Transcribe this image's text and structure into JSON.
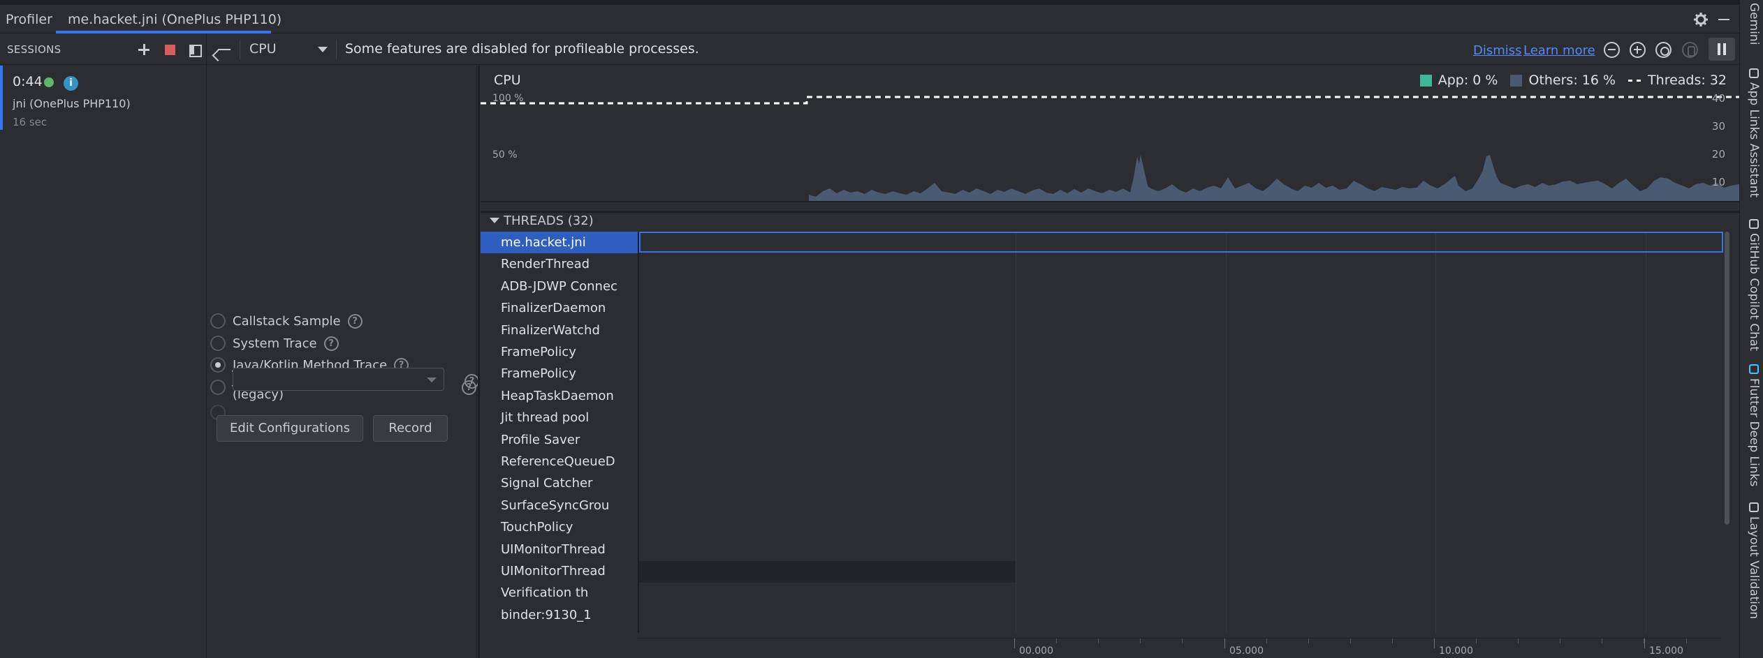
{
  "toolwindow": {
    "tabs": [
      "Profiler",
      "me.hacket.jni (OnePlus PHP110)"
    ]
  },
  "right_strip": {
    "items": [
      "Gemini",
      "App Links Assistant",
      "GitHub Copilot Chat",
      "Flutter Deep Links",
      "Layout Validation"
    ]
  },
  "sessions": {
    "title": "SESSIONS",
    "item": {
      "time": "0:44",
      "name": "jni (OnePlus PHP110)",
      "duration": "16 sec",
      "info_icon": "i"
    }
  },
  "config": {
    "options": [
      {
        "label": "Callstack Sample",
        "checked": false
      },
      {
        "label": "System Trace",
        "checked": false
      },
      {
        "label": "Java/Kotlin Method Trace",
        "checked": true
      },
      {
        "label": "Java/Kotlin Method Sample (legacy)",
        "checked": false
      }
    ],
    "help_glyph": "?",
    "dropdown_value": "",
    "edit_button": "Edit Configurations",
    "record_button": "Record"
  },
  "profiler_bar": {
    "monitor": "CPU",
    "message": "Some features are disabled for profileable processes.",
    "dismiss": "Dismiss",
    "learn_more": "Learn more"
  },
  "cpu_chart": {
    "title": "CPU",
    "legend": {
      "app": "App: 0 %",
      "others": "Others: 16 %",
      "threads": "Threads: 32"
    },
    "left_axis": [
      "100 %",
      "50 %"
    ],
    "right_axis": [
      "40",
      "30",
      "20",
      "10"
    ],
    "colors": {
      "app": "#3fb89a",
      "others": "#4a5a73",
      "threads": "#ffffff"
    }
  },
  "threads": {
    "header": "THREADS (32)",
    "list": [
      "me.hacket.jni",
      "RenderThread",
      "ADB-JDWP Connec",
      "FinalizerDaemon",
      "FinalizerWatchd",
      "FramePolicy",
      "FramePolicy",
      "HeapTaskDaemon",
      "Jit thread pool",
      "Profile Saver",
      "ReferenceQueueD",
      "Signal Catcher",
      "SurfaceSyncGrou",
      "TouchPolicy",
      "UIMonitorThread",
      "UIMonitorThread",
      "Verification th",
      "binder:9130_1"
    ],
    "selected_index": 0
  },
  "timeline": {
    "labels": [
      "00.000",
      "05.000",
      "10.000",
      "15.000"
    ]
  }
}
